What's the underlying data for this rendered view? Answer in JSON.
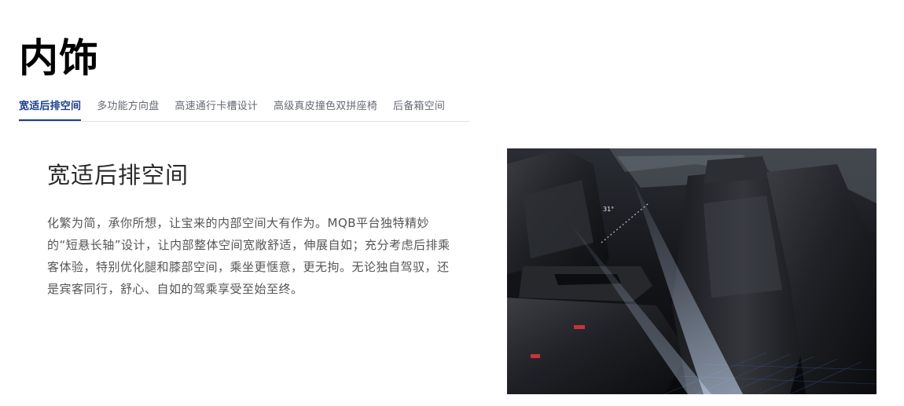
{
  "section": {
    "title": "内饰"
  },
  "tabs": [
    {
      "label": "宽适后排空间",
      "active": true
    },
    {
      "label": "多功能方向盘",
      "active": false
    },
    {
      "label": "高速通行卡槽设计",
      "active": false
    },
    {
      "label": "高级真皮撞色双拼座椅",
      "active": false
    },
    {
      "label": "后备箱空间",
      "active": false
    }
  ],
  "content": {
    "heading": "宽适后排空间",
    "body": "化繁为简，承你所想，让宝来的内部空间大有作为。MQB平台独特精妙的“短悬长轴”设计，让内部整体空间宽敞舒适，伸展自如；充分考虑后排乘客体验，特别优化腿和膝部空间，乘坐更惬意，更无拘。无论独自驾驭，还是宾客同行，舒心、自如的驾乘享受至始至终。",
    "image_label": "31°"
  },
  "colors": {
    "accent": "#1a3d8f",
    "tab_inactive": "#666a73",
    "body_text": "#555555",
    "divider": "#e3e3e3"
  }
}
